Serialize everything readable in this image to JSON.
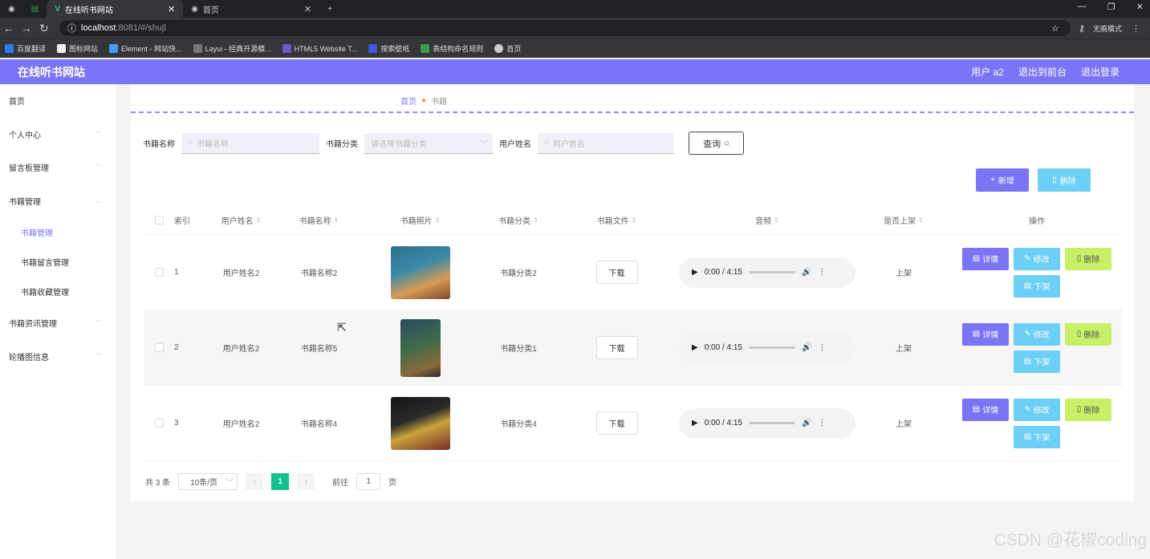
{
  "browser": {
    "tabs": [
      {
        "title": "在线听书网站"
      },
      {
        "title": "首页"
      }
    ],
    "url_host": "localhost",
    "url_rest": ":8081/#/shujl",
    "incognito_label": "无痕模式",
    "bookmarks": [
      "百度翻译",
      "图标网站",
      "Element - 网站快...",
      "Layui - 经典开源模...",
      "HTML5 Website T...",
      "搜索壁纸",
      "表结构命名规则",
      "首页"
    ]
  },
  "header": {
    "site_title": "在线听书网站",
    "user": "用户 a2",
    "back_front": "退出到前台",
    "logout": "退出登录"
  },
  "sidebar": {
    "items": [
      "首页",
      "个人中心",
      "留言板管理",
      "书籍管理",
      "书籍资讯管理",
      "轮播图信息"
    ],
    "sub_items": [
      "书籍管理",
      "书籍留言管理",
      "书籍收藏管理"
    ]
  },
  "breadcrumb": {
    "home": "首页",
    "current": "书籍"
  },
  "search": {
    "book_name_label": "书籍名称",
    "book_name_placeholder": "书籍名称",
    "category_label": "书籍分类",
    "category_placeholder": "请选择书籍分类",
    "user_name_label": "用户姓名",
    "user_name_placeholder": "用户姓名",
    "query_button": "查询"
  },
  "actions": {
    "add": "新增",
    "delete": "删除"
  },
  "table": {
    "headers": [
      "索引",
      "用户姓名",
      "书籍名称",
      "书籍照片",
      "书籍分类",
      "书籍文件",
      "音频",
      "是否上架",
      "操作"
    ],
    "rows": [
      {
        "index": "1",
        "user": "用户姓名2",
        "name": "书籍名称2",
        "category": "书籍分类2",
        "file": "下载",
        "audio_time": "0:00 / 4:15",
        "status": "上架"
      },
      {
        "index": "2",
        "user": "用户姓名2",
        "name": "书籍名称5",
        "category": "书籍分类1",
        "file": "下载",
        "audio_time": "0:00 / 4:15",
        "status": "上架"
      },
      {
        "index": "3",
        "user": "用户姓名2",
        "name": "书籍名称4",
        "category": "书籍分类4",
        "file": "下载",
        "audio_time": "0:00 / 4:15",
        "status": "上架"
      }
    ],
    "row_actions": {
      "detail": "详情",
      "edit": "修改",
      "delete": "删除",
      "unlist": "下架"
    }
  },
  "pagination": {
    "total": "共 3 条",
    "page_size": "10条/页",
    "current_page": "1",
    "goto_label": "前往",
    "goto_value": "1",
    "page_suffix": "页"
  },
  "watermark": "CSDN @花椒coding",
  "colors": {
    "primary": "#7b74f5",
    "cyan": "#6ccff5",
    "lime": "#c7f067",
    "pager_active": "#13c28e"
  }
}
